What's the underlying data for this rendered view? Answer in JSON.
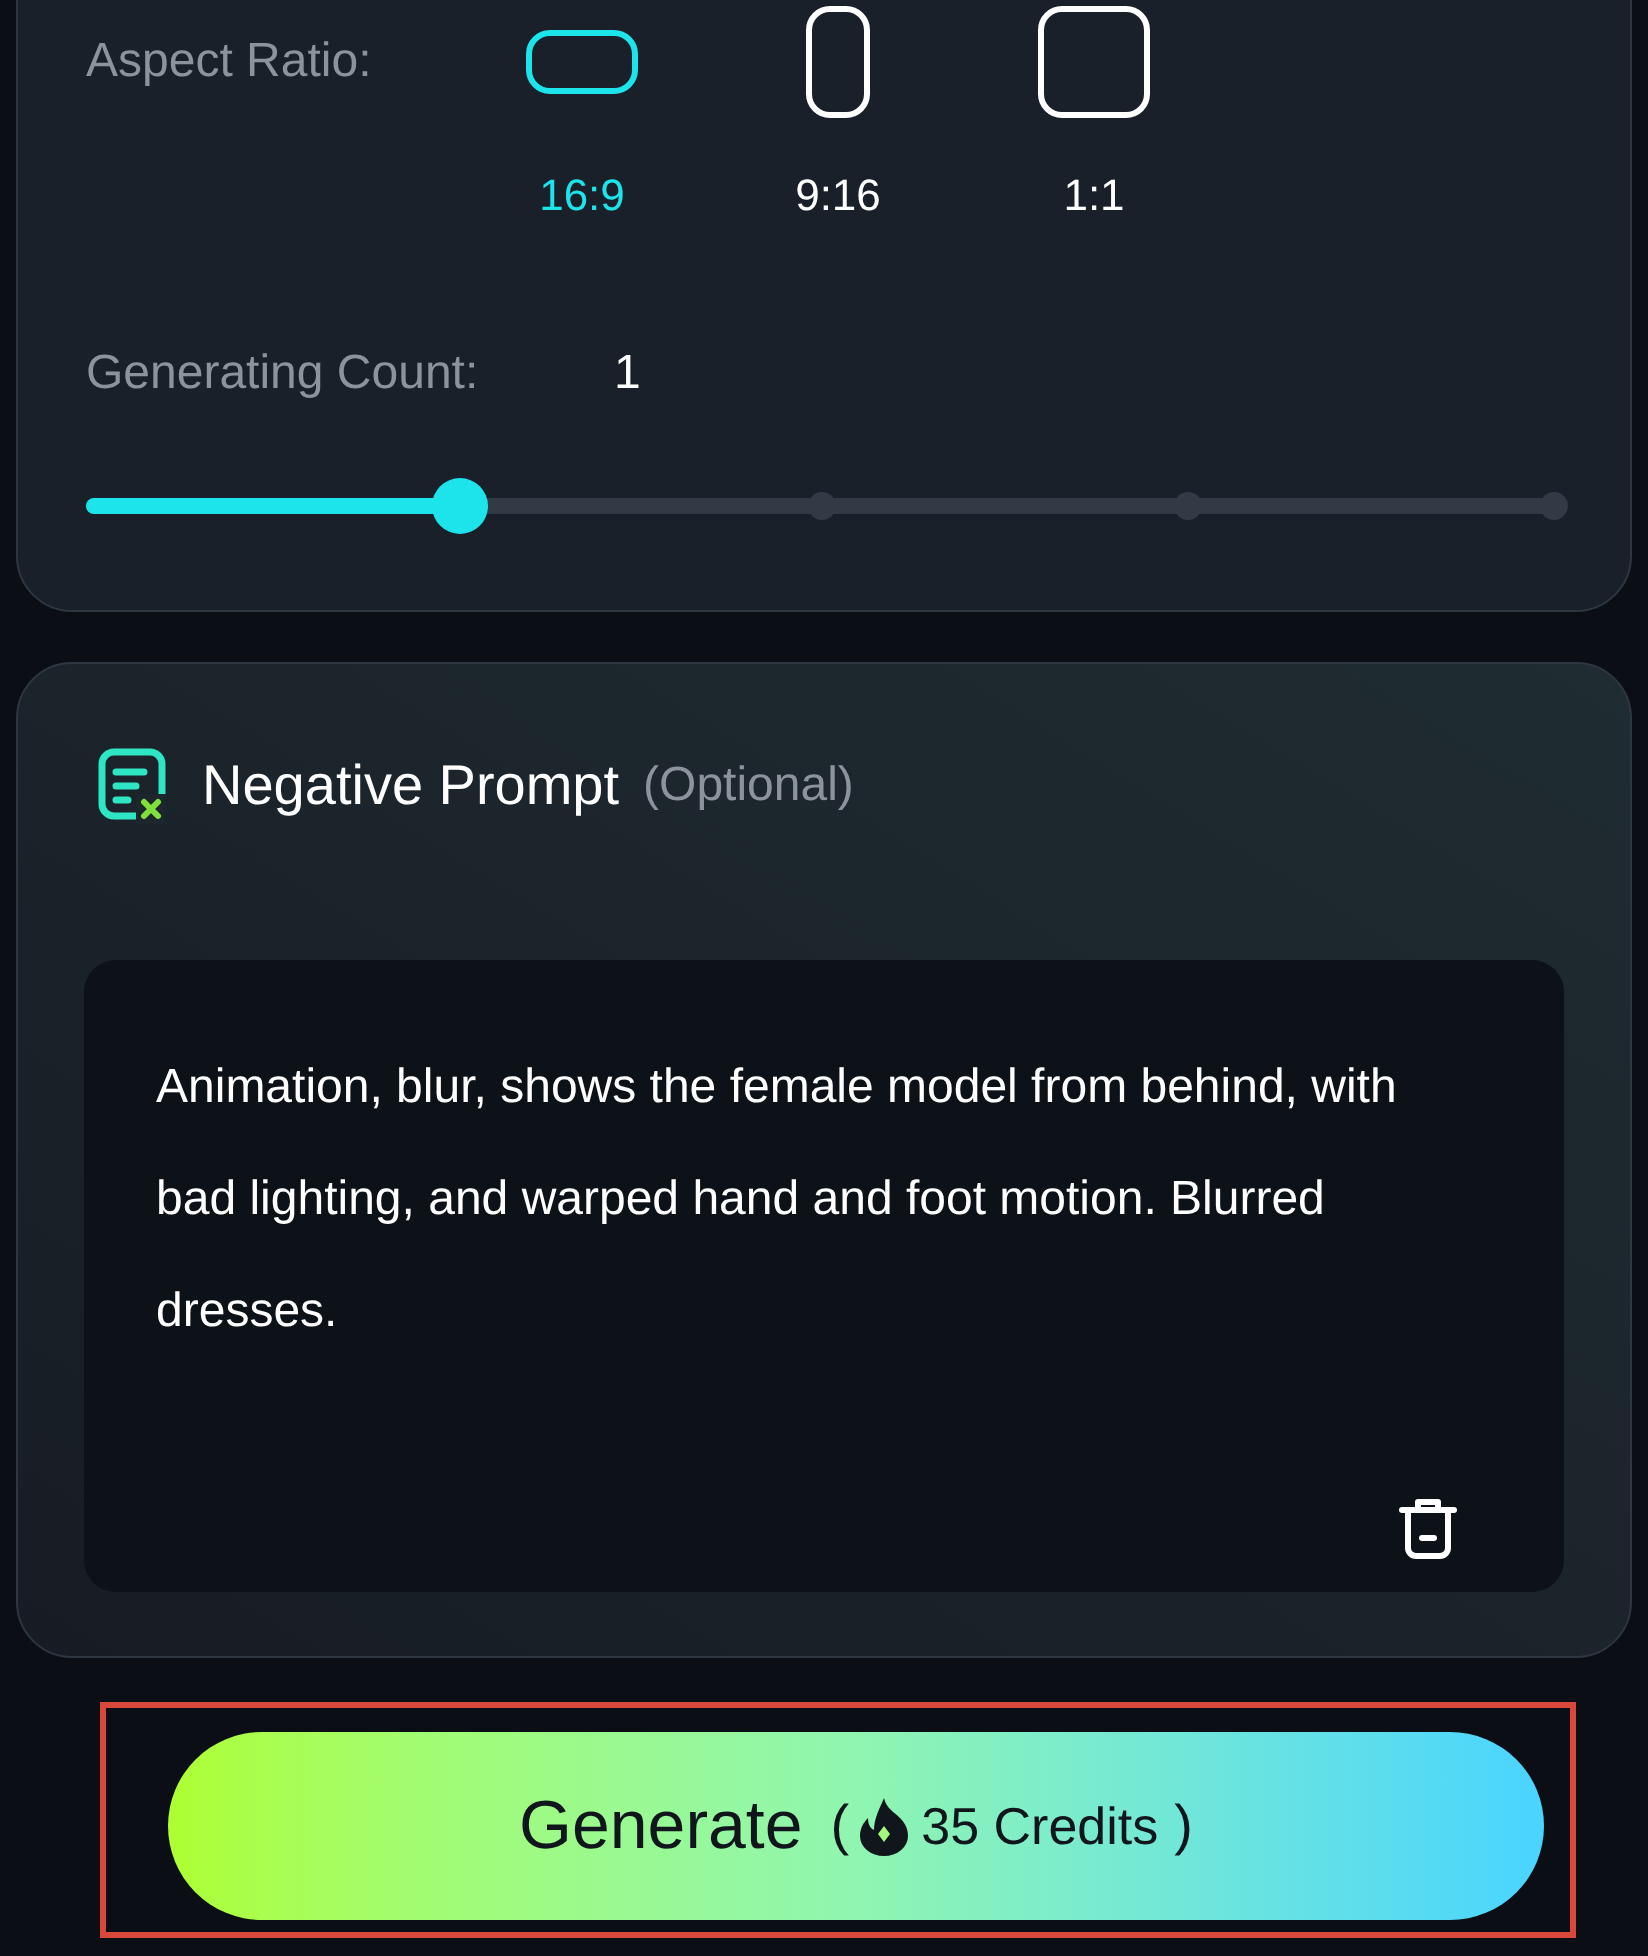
{
  "aspect_ratio": {
    "label": "Aspect Ratio:",
    "options": [
      {
        "label": "16:9",
        "kind": "landscape",
        "selected": true
      },
      {
        "label": "9:16",
        "kind": "portrait",
        "selected": false
      },
      {
        "label": "1:1",
        "kind": "square",
        "selected": false
      }
    ]
  },
  "generating_count": {
    "label": "Generating Count:",
    "value": "1",
    "level": 0.25
  },
  "negative_prompt": {
    "title": "Negative Prompt",
    "hint": "(Optional)",
    "value": "Animation, blur, shows the female model from behind, with bad lighting, and warped hand and foot motion. Blurred dresses."
  },
  "generate_button": {
    "label": "Generate",
    "open_paren": "(",
    "credits": "35 Credits",
    "close_paren": ")"
  }
}
